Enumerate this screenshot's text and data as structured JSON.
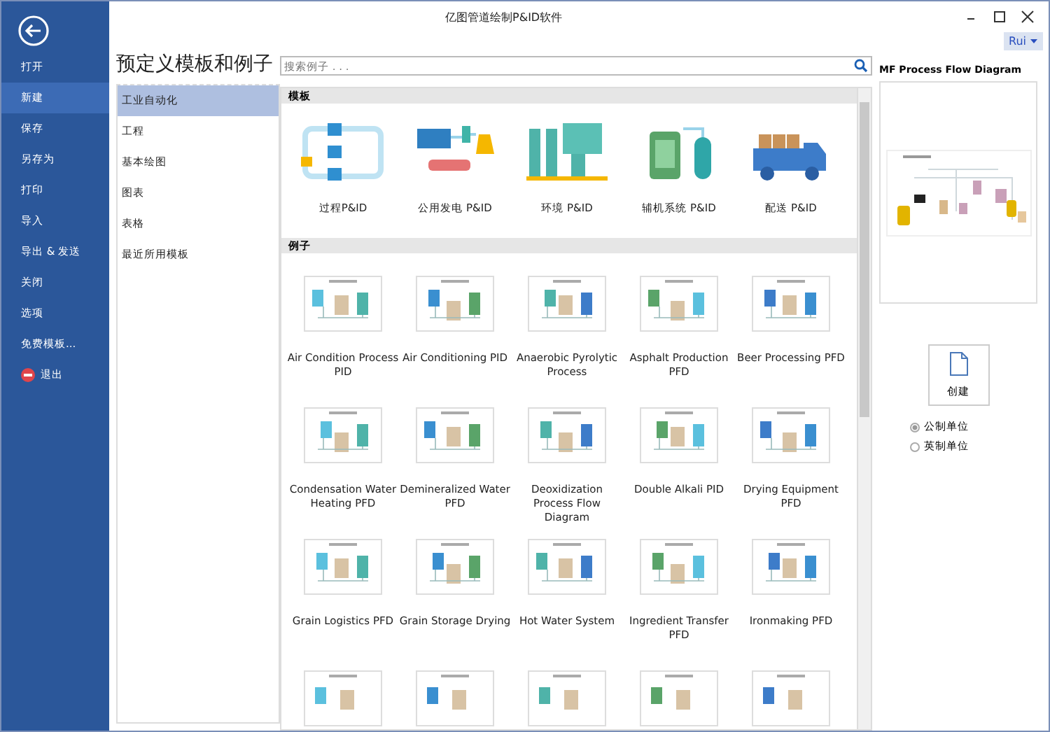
{
  "window": {
    "title": "亿图管道绘制P&ID软件"
  },
  "user": {
    "name": "Rui"
  },
  "sidebar": {
    "items": [
      {
        "label": "打开",
        "selected": false,
        "kind": "plain"
      },
      {
        "label": "新建",
        "selected": true,
        "kind": "plain"
      },
      {
        "label": "保存",
        "selected": false,
        "kind": "plain"
      },
      {
        "label": "另存为",
        "selected": false,
        "kind": "plain"
      },
      {
        "label": "打印",
        "selected": false,
        "kind": "plain"
      },
      {
        "label": "导入",
        "selected": false,
        "kind": "plain"
      },
      {
        "label": "导出 & 发送",
        "selected": false,
        "kind": "plain"
      },
      {
        "label": "关闭",
        "selected": false,
        "kind": "plain"
      },
      {
        "label": "选项",
        "selected": false,
        "kind": "plain"
      },
      {
        "label": "免费模板...",
        "selected": false,
        "kind": "plain"
      },
      {
        "label": "退出",
        "selected": false,
        "kind": "exit"
      }
    ]
  },
  "heading": "预定义模板和例子",
  "categories": [
    {
      "label": "工业自动化",
      "selected": true
    },
    {
      "label": "工程",
      "selected": false
    },
    {
      "label": "基本绘图",
      "selected": false
    },
    {
      "label": "图表",
      "selected": false
    },
    {
      "label": "表格",
      "selected": false
    },
    {
      "label": "最近所用模板",
      "selected": false
    }
  ],
  "search": {
    "placeholder": "搜索例子 . . ."
  },
  "templates": {
    "header": "模板",
    "items": [
      {
        "label": "过程P&ID"
      },
      {
        "label": "公用发电 P&ID"
      },
      {
        "label": "环境 P&ID"
      },
      {
        "label": "辅机系统 P&ID"
      },
      {
        "label": "配送 P&ID"
      }
    ]
  },
  "examples": {
    "header": "例子",
    "items": [
      {
        "label": "Air Condition Process PID"
      },
      {
        "label": "Air Conditioning PID"
      },
      {
        "label": "Anaerobic Pyrolytic Process"
      },
      {
        "label": "Asphalt Production PFD"
      },
      {
        "label": "Beer Processing PFD"
      },
      {
        "label": "Condensation Water Heating PFD"
      },
      {
        "label": "Demineralized Water PFD"
      },
      {
        "label": "Deoxidization Process Flow Diagram"
      },
      {
        "label": "Double Alkali PID"
      },
      {
        "label": "Drying Equipment PFD"
      },
      {
        "label": "Grain Logistics PFD"
      },
      {
        "label": "Grain Storage Drying"
      },
      {
        "label": "Hot Water System"
      },
      {
        "label": "Ingredient Transfer PFD"
      },
      {
        "label": "Ironmaking PFD"
      }
    ]
  },
  "preview": {
    "title": "MF Process Flow Diagram",
    "create_label": "创建"
  },
  "units": [
    {
      "label": "公制单位",
      "selected": true
    },
    {
      "label": "英制单位",
      "selected": false
    }
  ]
}
